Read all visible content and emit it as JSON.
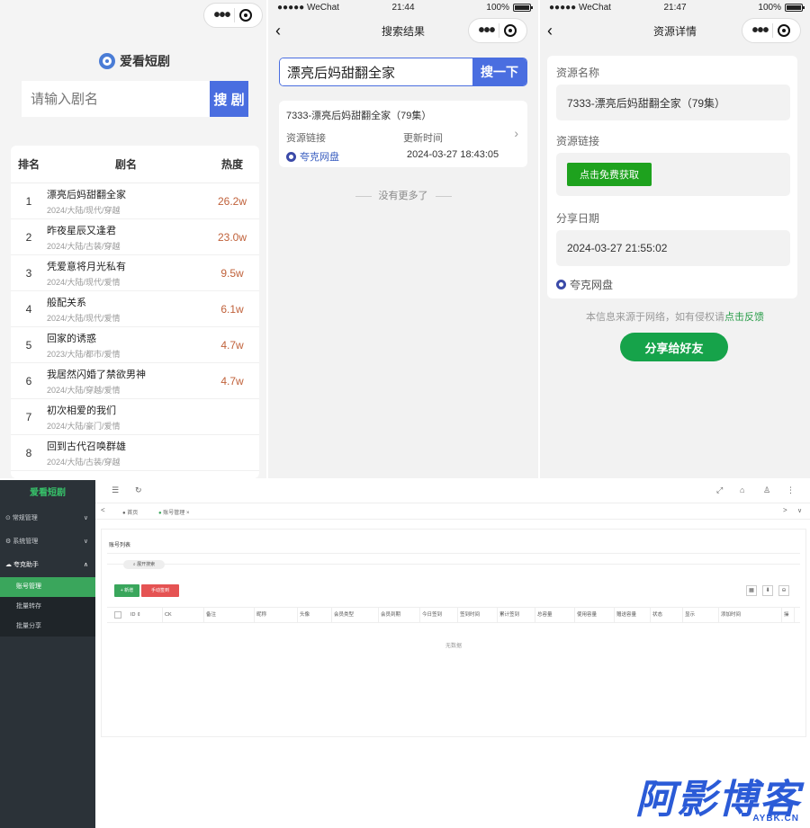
{
  "panel1": {
    "capsule": {
      "more": "•••"
    },
    "app_name": "爱看短剧",
    "search": {
      "placeholder": "请输入剧名",
      "button": "搜 剧"
    },
    "table": {
      "headers": [
        "排名",
        "剧名",
        "热度"
      ],
      "rows": [
        {
          "rank": "1",
          "name": "漂亮后妈甜翻全家",
          "meta": "2024/大陆/现代/穿越",
          "heat": "26.2w"
        },
        {
          "rank": "2",
          "name": "昨夜星辰又逢君",
          "meta": "2024/大陆/古装/穿越",
          "heat": "23.0w"
        },
        {
          "rank": "3",
          "name": "凭爱意将月光私有",
          "meta": "2024/大陆/现代/爱情",
          "heat": "9.5w"
        },
        {
          "rank": "4",
          "name": "般配关系",
          "meta": "2024/大陆/现代/爱情",
          "heat": "6.1w"
        },
        {
          "rank": "5",
          "name": "回家的诱惑",
          "meta": "2023/大陆/都市/爱情",
          "heat": "4.7w"
        },
        {
          "rank": "6",
          "name": "我居然闪婚了禁欲男神",
          "meta": "2024/大陆/穿越/爱情",
          "heat": "4.7w"
        },
        {
          "rank": "7",
          "name": "初次相爱的我们",
          "meta": "2024/大陆/豪门/爱情",
          "heat": ""
        },
        {
          "rank": "8",
          "name": "回到古代召唤群雄",
          "meta": "2024/大陆/古装/穿越",
          "heat": ""
        }
      ]
    }
  },
  "panel2": {
    "status": {
      "signal": "●●●●● WeChat",
      "time": "21:44",
      "battery": "100%"
    },
    "nav_title": "搜索结果",
    "search": {
      "value": "漂亮后妈甜翻全家",
      "button": "搜一下"
    },
    "result": {
      "title": "7333-漂亮后妈甜翻全家（79集）",
      "link_label": "资源链接",
      "time_label": "更新时间",
      "disk": "夸克网盘",
      "updated": "2024-03-27 18:43:05"
    },
    "no_more": "没有更多了"
  },
  "panel3": {
    "status": {
      "signal": "●●●●● WeChat",
      "time": "21:47",
      "battery": "100%"
    },
    "nav_title": "资源详情",
    "name_label": "资源名称",
    "name_value": "7333-漂亮后妈甜翻全家（79集）",
    "link_label": "资源链接",
    "get_button": "点击免费获取",
    "date_label": "分享日期",
    "date_value": "2024-03-27 21:55:02",
    "disk": "夸克网盘",
    "note_prefix": "本信息来源于网络，如有侵权请",
    "note_link": "点击反馈",
    "share_button": "分享给好友"
  },
  "admin": {
    "brand": "爱看短剧",
    "menu": [
      {
        "label": "常规管理",
        "arrow": "∨"
      },
      {
        "label": "系统管理",
        "arrow": "∨"
      },
      {
        "label": "夸克助手",
        "arrow": "∧"
      }
    ],
    "submenu": [
      "账号管理",
      "批量转存",
      "批量分享"
    ],
    "topbar": {
      "menu": "☰",
      "refresh": "↻",
      "expand": "⤢",
      "home": "⌂",
      "user": "♙",
      "more": "⋮"
    },
    "tabs": {
      "prev": "<",
      "home": "首页",
      "current": "账号管理",
      "next": ">",
      "dropdown": "∨"
    },
    "page_title": "账号列表",
    "expand_search": "展开搜索",
    "buttons": {
      "add": "+ 新增",
      "sign": "手动签到"
    },
    "tools": [
      "▦",
      "⬇",
      "⊖"
    ],
    "columns": [
      "ID ⇕",
      "CK",
      "备注",
      "昵称",
      "头像",
      "会员类型",
      "会员到期",
      "今日签到",
      "签到时间",
      "累计签到",
      "总容量",
      "使用容量",
      "赠送容量",
      "状态",
      "显示",
      "添加时间",
      "操"
    ],
    "empty": "无数据"
  },
  "watermark": {
    "main": "阿影博客",
    "sub": "AYBK.CN"
  },
  "colors": {
    "primary_blue": "#4a6ee0",
    "green": "#16a34a",
    "sidebar": "#2b3238",
    "heat": "#c0613a"
  }
}
